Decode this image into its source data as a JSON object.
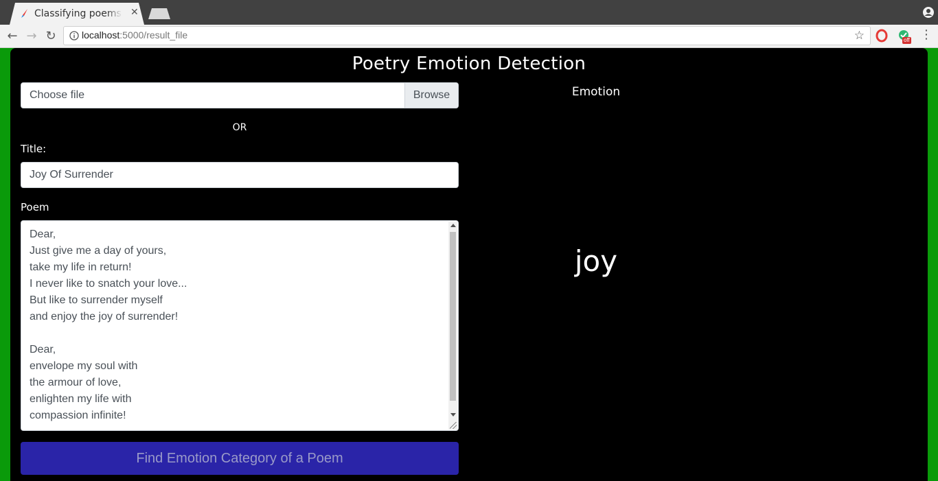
{
  "browser": {
    "tab_title": "Classifying poems by emotion",
    "url_host": "localhost",
    "url_rest": ":5000/result_file",
    "extension_badge": "off"
  },
  "page": {
    "heading": "Poetry Emotion Detection",
    "file_input": {
      "placeholder": "Choose file",
      "browse_label": "Browse"
    },
    "or_text": "OR",
    "title_label": "Title:",
    "title_value": "Joy Of Surrender",
    "poem_label": "Poem",
    "poem_value": "Dear,\nJust give me a day of yours,\ntake my life in return!\nI never like to snatch your love...\nBut like to surrender myself\nand enjoy the joy of surrender!\n\nDear,\nenvelope my soul with\nthe armour of love,\nenlighten my life with\ncompassion infinite!",
    "submit_label": "Find Emotion Category of a Poem",
    "emotion_label": "Emotion",
    "emotion_value": "joy"
  },
  "colors": {
    "page_background": "#0a9a0a",
    "panel_background": "#000000",
    "submit_button": "#2a24a8"
  }
}
